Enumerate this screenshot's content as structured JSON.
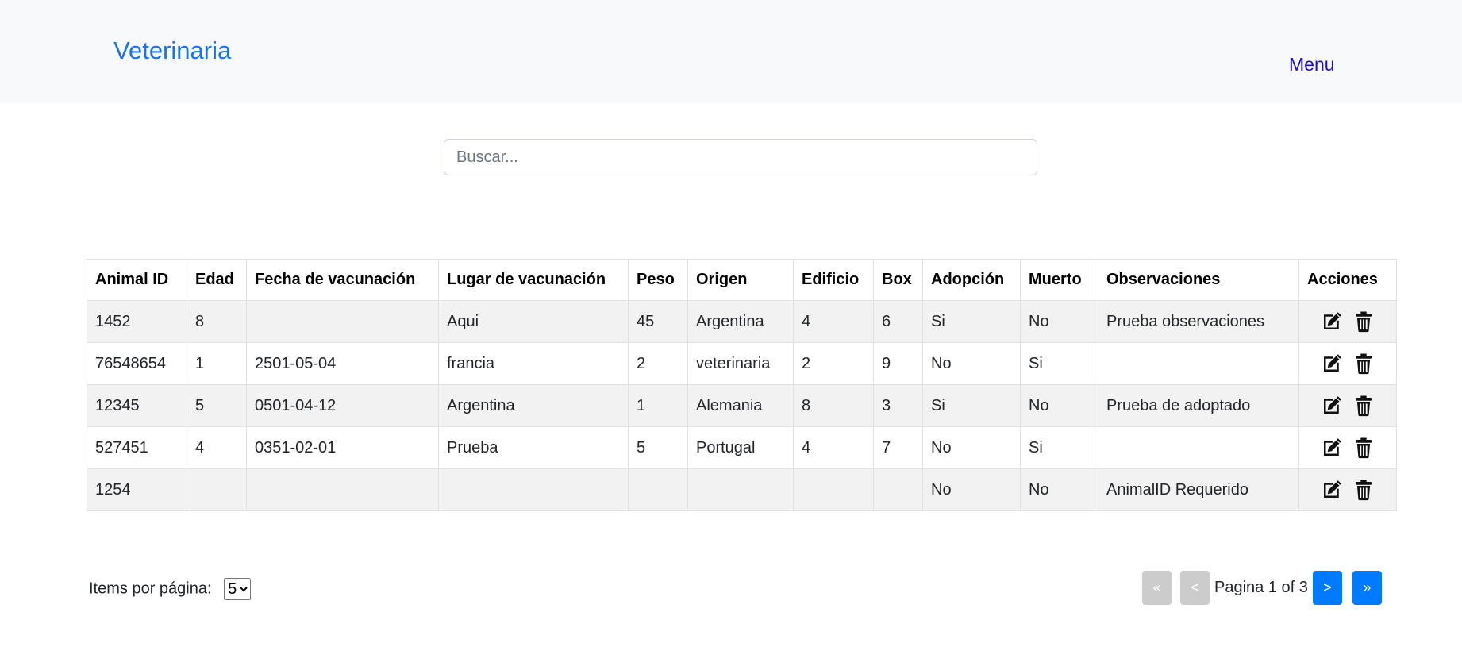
{
  "navbar": {
    "brand": "Veterinaria",
    "menu_label": "Menu"
  },
  "search": {
    "placeholder": "Buscar...",
    "value": ""
  },
  "table": {
    "headers": [
      "Animal ID",
      "Edad",
      "Fecha de vacunación",
      "Lugar de vacunación",
      "Peso",
      "Origen",
      "Edificio",
      "Box",
      "Adopción",
      "Muerto",
      "Observaciones",
      "Acciones"
    ],
    "rows": [
      [
        "1452",
        "8",
        "",
        "Aqui",
        "45",
        "Argentina",
        "4",
        "6",
        "Si",
        "No",
        "Prueba observaciones"
      ],
      [
        "76548654",
        "1",
        "2501-05-04",
        "francia",
        "2",
        "veterinaria",
        "2",
        "9",
        "No",
        "Si",
        ""
      ],
      [
        "12345",
        "5",
        "0501-04-12",
        "Argentina",
        "1",
        "Alemania",
        "8",
        "3",
        "Si",
        "No",
        "Prueba de adoptado"
      ],
      [
        "527451",
        "4",
        "0351-02-01",
        "Prueba",
        "5",
        "Portugal",
        "4",
        "7",
        "No",
        "Si",
        ""
      ],
      [
        "1254",
        "",
        "",
        "",
        "",
        "",
        "",
        "",
        "No",
        "No",
        "AnimalID Requerido"
      ]
    ],
    "row_actions": [
      {
        "icon": "edit-icon",
        "label": "Editar"
      },
      {
        "icon": "trash-icon",
        "label": "Eliminar"
      }
    ]
  },
  "pagination": {
    "items_label": "Items por página:",
    "per_page_selected": "5",
    "first_label": "«",
    "prev_label": "<",
    "info": "Pagina 1 of 3",
    "next_label": ">",
    "last_label": "»"
  },
  "colors": {
    "brand": "#1a73e8",
    "menu": "#1a0dcc",
    "active_button": "#007bff",
    "disabled_button": "#cccccc",
    "stripe": "#f2f2f2"
  }
}
